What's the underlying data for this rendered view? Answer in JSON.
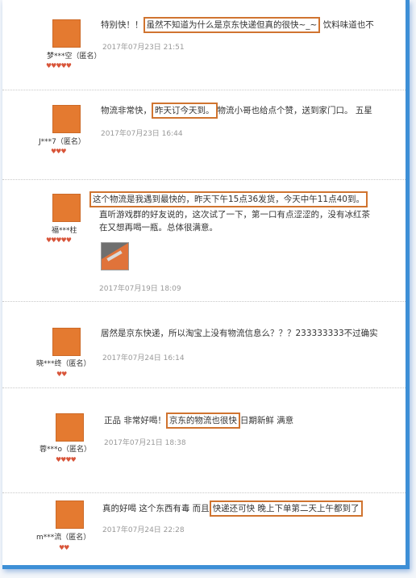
{
  "reviews": [
    {
      "user": "梦***空（匿名）",
      "hearts": "♥♥♥♥♥",
      "text_before": "特别快！！",
      "text_highlight": "虽然不知道为什么是京东快递但真的很快~_~",
      "text_after": " 饮料味道也不",
      "date": "2017年07月23日 21:51"
    },
    {
      "user": "J***7（匿名）",
      "hearts": "♥♥♥",
      "text_before": "物流非常快，",
      "text_highlight": "昨天订今天到。",
      "text_after": "物流小哥也给点个赞，送到家门口。 五星",
      "date": "2017年07月23日 16:44"
    },
    {
      "user": "福***柱",
      "hearts": "♥♥♥♥♥",
      "text_highlight": "这个物流是我遇到最快的，昨天下午15点36发货，今天中午11点40到。",
      "line2": "直听游戏群的好友说的，这次试了一下，第一口有点涩涩的，没有冰红茶",
      "line3": "在又想再喝一瓶。总体很满意。",
      "date": "2017年07月19日 18:09"
    },
    {
      "user": "晓***终（匿名）",
      "hearts": "♥♥",
      "text_before": "居然是京东快递，所以淘宝上没有物流信息么？？？233333333不过确实",
      "date": "2017年07月24日 16:14"
    },
    {
      "user": "蓉***o（匿名）",
      "hearts": "♥♥♥♥",
      "text_before": "正品 非常好喝！",
      "text_highlight": "京东的物流也很快",
      "text_after": "日期新鲜 满意",
      "date": "2017年07月21日 18:38"
    },
    {
      "user": "m***流（匿名）",
      "hearts": "♥♥",
      "text_before": "真的好喝 这个东西有毒 而且",
      "text_highlight": "快递还可快 晚上下单第二天上午都到了",
      "date": "2017年07月24日 22:28"
    }
  ]
}
